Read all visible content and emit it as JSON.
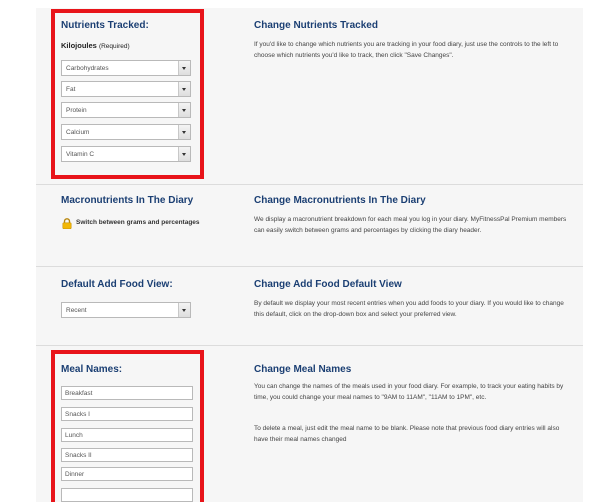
{
  "nutrients": {
    "title": "Nutrients Tracked:",
    "required_label": "Kilojoules",
    "required_suffix": "(Required)",
    "selects": [
      "Carbohydrates",
      "Fat",
      "Protein",
      "Calcium",
      "Vitamin C"
    ],
    "right_title": "Change Nutrients Tracked",
    "right_desc": "If you'd like to change which nutrients you are tracking in your food diary, just use the controls to the left to choose which nutrients you'd like to track, then click \"Save Changes\"."
  },
  "macros": {
    "title": "Macronutrients In The Diary",
    "lock_text": "Switch between grams and percentages",
    "right_title": "Change Macronutrients In The Diary",
    "right_desc": "We display a macronutrient breakdown for each meal you log in your diary. MyFitnessPal Premium members can easily switch between grams and percentages by clicking the diary header."
  },
  "add_food": {
    "title": "Default Add Food View:",
    "selected": "Recent",
    "right_title": "Change Add Food Default View",
    "right_desc": "By default we display your most recent entries when you add foods to your diary. If you would like to change this default, click on the drop-down box and select your preferred view."
  },
  "meals": {
    "title": "Meal Names:",
    "names": [
      "Breakfast",
      "Snacks I",
      "Lunch",
      "Snacks II",
      "Dinner",
      ""
    ],
    "right_title": "Change Meal Names",
    "right_desc_1": "You can change the names of the meals used in your food diary. For example, to track your eating habits by time, you could change your meal names to \"9AM to 11AM\", \"11AM to 1PM\", etc.",
    "right_desc_2": "To delete a meal, just edit the meal name to be blank. Please note that previous food diary entries will also have their meal names changed"
  },
  "colors": {
    "heading": "#1b3f73",
    "highlight": "#e8141a",
    "panel": "#f6f6f6"
  }
}
